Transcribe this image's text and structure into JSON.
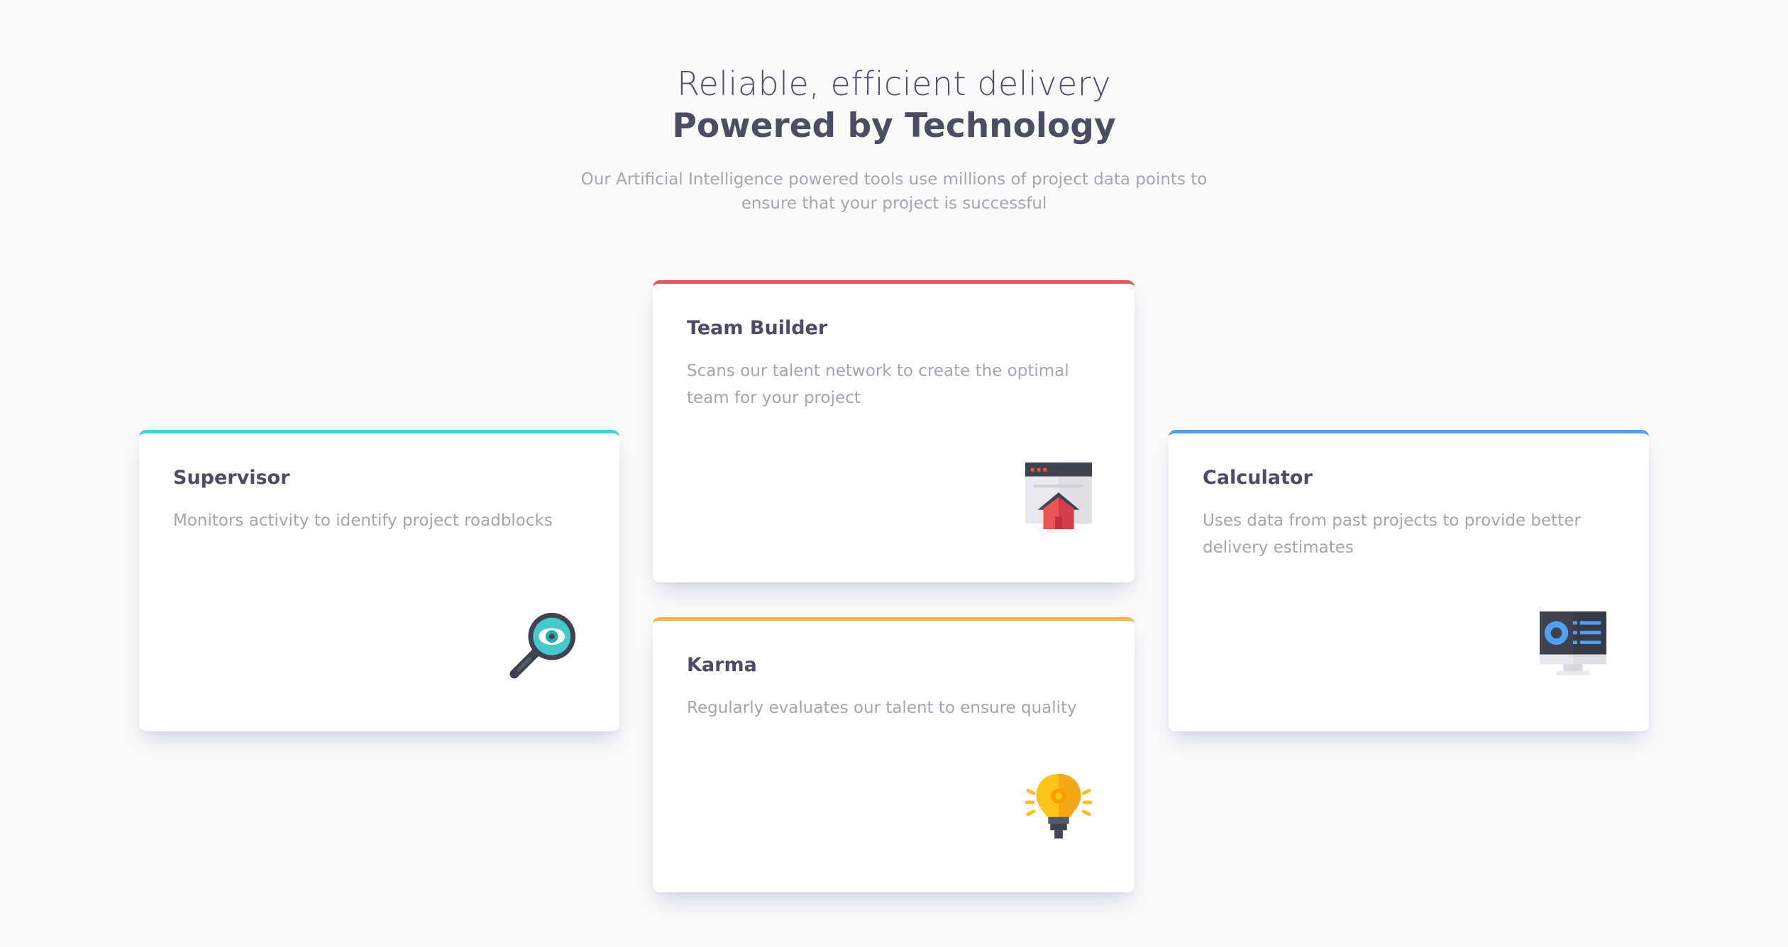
{
  "header": {
    "title_light": "Reliable, efficient delivery",
    "title_strong": "Powered by Technology",
    "description": "Our Artificial Intelligence powered tools use millions of project data points to ensure that your project is successful"
  },
  "cards": [
    {
      "title": "Supervisor",
      "description": "Monitors activity to identify project roadblocks",
      "icon": "magnifier-eye-icon",
      "accent": "#44d3d2"
    },
    {
      "title": "Team Builder",
      "description": "Scans our talent network to create the optimal team for your project",
      "icon": "browser-house-icon",
      "accent": "#ea5454"
    },
    {
      "title": "Karma",
      "description": "Regularly evaluates our talent to ensure quality",
      "icon": "lightbulb-icon",
      "accent": "#fcaf4a"
    },
    {
      "title": "Calculator",
      "description": "Uses data from past projects to provide better delivery estimates",
      "icon": "monitor-calculator-icon",
      "accent": "#549ef2"
    }
  ],
  "colors": {
    "background": "#fafafa",
    "heading": "#4b4d63",
    "body_text": "#a4a5b0",
    "card_background": "#ffffff"
  }
}
